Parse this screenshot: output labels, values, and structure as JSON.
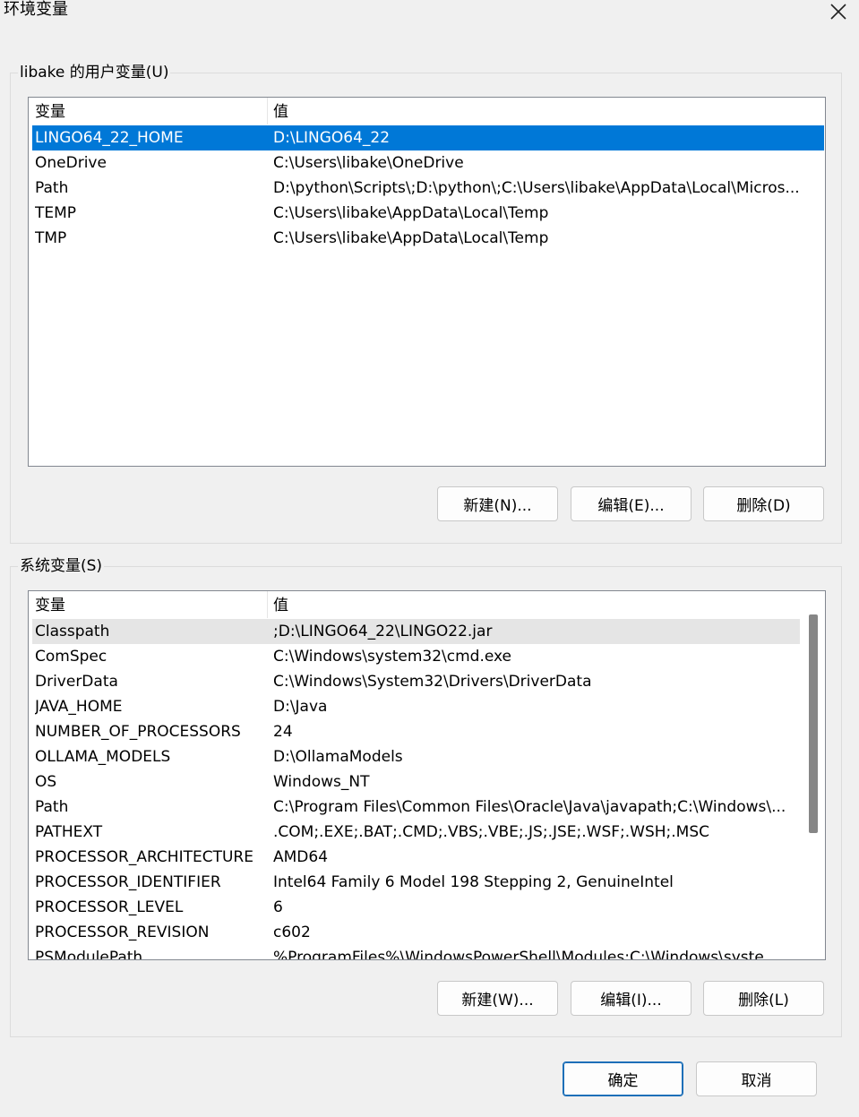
{
  "window": {
    "title": "环境变量"
  },
  "user_vars": {
    "group_label": "libake 的用户变量(U)",
    "headers": {
      "name": "变量",
      "value": "值"
    },
    "rows": [
      {
        "name": "LINGO64_22_HOME",
        "value": "D:\\LINGO64_22"
      },
      {
        "name": "OneDrive",
        "value": "C:\\Users\\libake\\OneDrive"
      },
      {
        "name": "Path",
        "value": "D:\\python\\Scripts\\;D:\\python\\;C:\\Users\\libake\\AppData\\Local\\Micros..."
      },
      {
        "name": "TEMP",
        "value": "C:\\Users\\libake\\AppData\\Local\\Temp"
      },
      {
        "name": "TMP",
        "value": "C:\\Users\\libake\\AppData\\Local\\Temp"
      }
    ],
    "buttons": {
      "new": "新建(N)...",
      "edit": "编辑(E)...",
      "delete": "删除(D)"
    }
  },
  "system_vars": {
    "group_label": "系统变量(S)",
    "headers": {
      "name": "变量",
      "value": "值"
    },
    "rows": [
      {
        "name": "Classpath",
        "value": ";D:\\LINGO64_22\\LINGO22.jar"
      },
      {
        "name": "ComSpec",
        "value": "C:\\Windows\\system32\\cmd.exe"
      },
      {
        "name": "DriverData",
        "value": "C:\\Windows\\System32\\Drivers\\DriverData"
      },
      {
        "name": "JAVA_HOME",
        "value": "D:\\Java"
      },
      {
        "name": "NUMBER_OF_PROCESSORS",
        "value": "24"
      },
      {
        "name": "OLLAMA_MODELS",
        "value": "D:\\OllamaModels"
      },
      {
        "name": "OS",
        "value": "Windows_NT"
      },
      {
        "name": "Path",
        "value": "C:\\Program Files\\Common Files\\Oracle\\Java\\javapath;C:\\Windows\\..."
      },
      {
        "name": "PATHEXT",
        "value": ".COM;.EXE;.BAT;.CMD;.VBS;.VBE;.JS;.JSE;.WSF;.WSH;.MSC"
      },
      {
        "name": "PROCESSOR_ARCHITECTURE",
        "value": "AMD64"
      },
      {
        "name": "PROCESSOR_IDENTIFIER",
        "value": "Intel64 Family 6 Model 198 Stepping 2, GenuineIntel"
      },
      {
        "name": "PROCESSOR_LEVEL",
        "value": "6"
      },
      {
        "name": "PROCESSOR_REVISION",
        "value": "c602"
      },
      {
        "name": "PSModulePath",
        "value": "%ProgramFiles%\\WindowsPowerShell\\Modules;C:\\Windows\\syste..."
      }
    ],
    "buttons": {
      "new": "新建(W)...",
      "edit": "编辑(I)...",
      "delete": "删除(L)"
    }
  },
  "dialog_buttons": {
    "ok": "确定",
    "cancel": "取消"
  },
  "colors": {
    "selection": "#0078d7",
    "hover": "#e5e5e5",
    "background": "#f0f0f0"
  },
  "icons": {
    "close": "close-icon"
  }
}
